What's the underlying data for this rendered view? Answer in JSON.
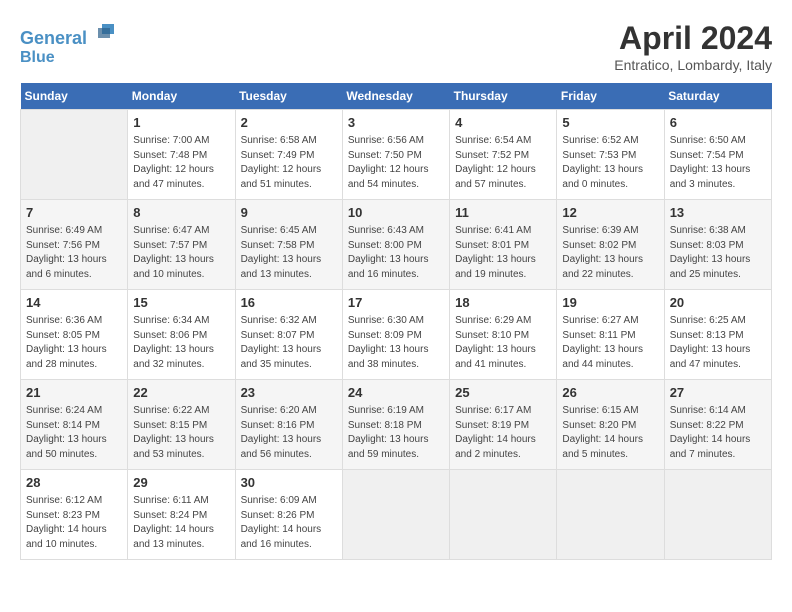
{
  "header": {
    "logo_line1": "General",
    "logo_line2": "Blue",
    "month_title": "April 2024",
    "location": "Entratico, Lombardy, Italy"
  },
  "weekdays": [
    "Sunday",
    "Monday",
    "Tuesday",
    "Wednesday",
    "Thursday",
    "Friday",
    "Saturday"
  ],
  "weeks": [
    [
      {
        "day": "",
        "info": ""
      },
      {
        "day": "1",
        "info": "Sunrise: 7:00 AM\nSunset: 7:48 PM\nDaylight: 12 hours\nand 47 minutes."
      },
      {
        "day": "2",
        "info": "Sunrise: 6:58 AM\nSunset: 7:49 PM\nDaylight: 12 hours\nand 51 minutes."
      },
      {
        "day": "3",
        "info": "Sunrise: 6:56 AM\nSunset: 7:50 PM\nDaylight: 12 hours\nand 54 minutes."
      },
      {
        "day": "4",
        "info": "Sunrise: 6:54 AM\nSunset: 7:52 PM\nDaylight: 12 hours\nand 57 minutes."
      },
      {
        "day": "5",
        "info": "Sunrise: 6:52 AM\nSunset: 7:53 PM\nDaylight: 13 hours\nand 0 minutes."
      },
      {
        "day": "6",
        "info": "Sunrise: 6:50 AM\nSunset: 7:54 PM\nDaylight: 13 hours\nand 3 minutes."
      }
    ],
    [
      {
        "day": "7",
        "info": "Sunrise: 6:49 AM\nSunset: 7:56 PM\nDaylight: 13 hours\nand 6 minutes."
      },
      {
        "day": "8",
        "info": "Sunrise: 6:47 AM\nSunset: 7:57 PM\nDaylight: 13 hours\nand 10 minutes."
      },
      {
        "day": "9",
        "info": "Sunrise: 6:45 AM\nSunset: 7:58 PM\nDaylight: 13 hours\nand 13 minutes."
      },
      {
        "day": "10",
        "info": "Sunrise: 6:43 AM\nSunset: 8:00 PM\nDaylight: 13 hours\nand 16 minutes."
      },
      {
        "day": "11",
        "info": "Sunrise: 6:41 AM\nSunset: 8:01 PM\nDaylight: 13 hours\nand 19 minutes."
      },
      {
        "day": "12",
        "info": "Sunrise: 6:39 AM\nSunset: 8:02 PM\nDaylight: 13 hours\nand 22 minutes."
      },
      {
        "day": "13",
        "info": "Sunrise: 6:38 AM\nSunset: 8:03 PM\nDaylight: 13 hours\nand 25 minutes."
      }
    ],
    [
      {
        "day": "14",
        "info": "Sunrise: 6:36 AM\nSunset: 8:05 PM\nDaylight: 13 hours\nand 28 minutes."
      },
      {
        "day": "15",
        "info": "Sunrise: 6:34 AM\nSunset: 8:06 PM\nDaylight: 13 hours\nand 32 minutes."
      },
      {
        "day": "16",
        "info": "Sunrise: 6:32 AM\nSunset: 8:07 PM\nDaylight: 13 hours\nand 35 minutes."
      },
      {
        "day": "17",
        "info": "Sunrise: 6:30 AM\nSunset: 8:09 PM\nDaylight: 13 hours\nand 38 minutes."
      },
      {
        "day": "18",
        "info": "Sunrise: 6:29 AM\nSunset: 8:10 PM\nDaylight: 13 hours\nand 41 minutes."
      },
      {
        "day": "19",
        "info": "Sunrise: 6:27 AM\nSunset: 8:11 PM\nDaylight: 13 hours\nand 44 minutes."
      },
      {
        "day": "20",
        "info": "Sunrise: 6:25 AM\nSunset: 8:13 PM\nDaylight: 13 hours\nand 47 minutes."
      }
    ],
    [
      {
        "day": "21",
        "info": "Sunrise: 6:24 AM\nSunset: 8:14 PM\nDaylight: 13 hours\nand 50 minutes."
      },
      {
        "day": "22",
        "info": "Sunrise: 6:22 AM\nSunset: 8:15 PM\nDaylight: 13 hours\nand 53 minutes."
      },
      {
        "day": "23",
        "info": "Sunrise: 6:20 AM\nSunset: 8:16 PM\nDaylight: 13 hours\nand 56 minutes."
      },
      {
        "day": "24",
        "info": "Sunrise: 6:19 AM\nSunset: 8:18 PM\nDaylight: 13 hours\nand 59 minutes."
      },
      {
        "day": "25",
        "info": "Sunrise: 6:17 AM\nSunset: 8:19 PM\nDaylight: 14 hours\nand 2 minutes."
      },
      {
        "day": "26",
        "info": "Sunrise: 6:15 AM\nSunset: 8:20 PM\nDaylight: 14 hours\nand 5 minutes."
      },
      {
        "day": "27",
        "info": "Sunrise: 6:14 AM\nSunset: 8:22 PM\nDaylight: 14 hours\nand 7 minutes."
      }
    ],
    [
      {
        "day": "28",
        "info": "Sunrise: 6:12 AM\nSunset: 8:23 PM\nDaylight: 14 hours\nand 10 minutes."
      },
      {
        "day": "29",
        "info": "Sunrise: 6:11 AM\nSunset: 8:24 PM\nDaylight: 14 hours\nand 13 minutes."
      },
      {
        "day": "30",
        "info": "Sunrise: 6:09 AM\nSunset: 8:26 PM\nDaylight: 14 hours\nand 16 minutes."
      },
      {
        "day": "",
        "info": ""
      },
      {
        "day": "",
        "info": ""
      },
      {
        "day": "",
        "info": ""
      },
      {
        "day": "",
        "info": ""
      }
    ]
  ]
}
